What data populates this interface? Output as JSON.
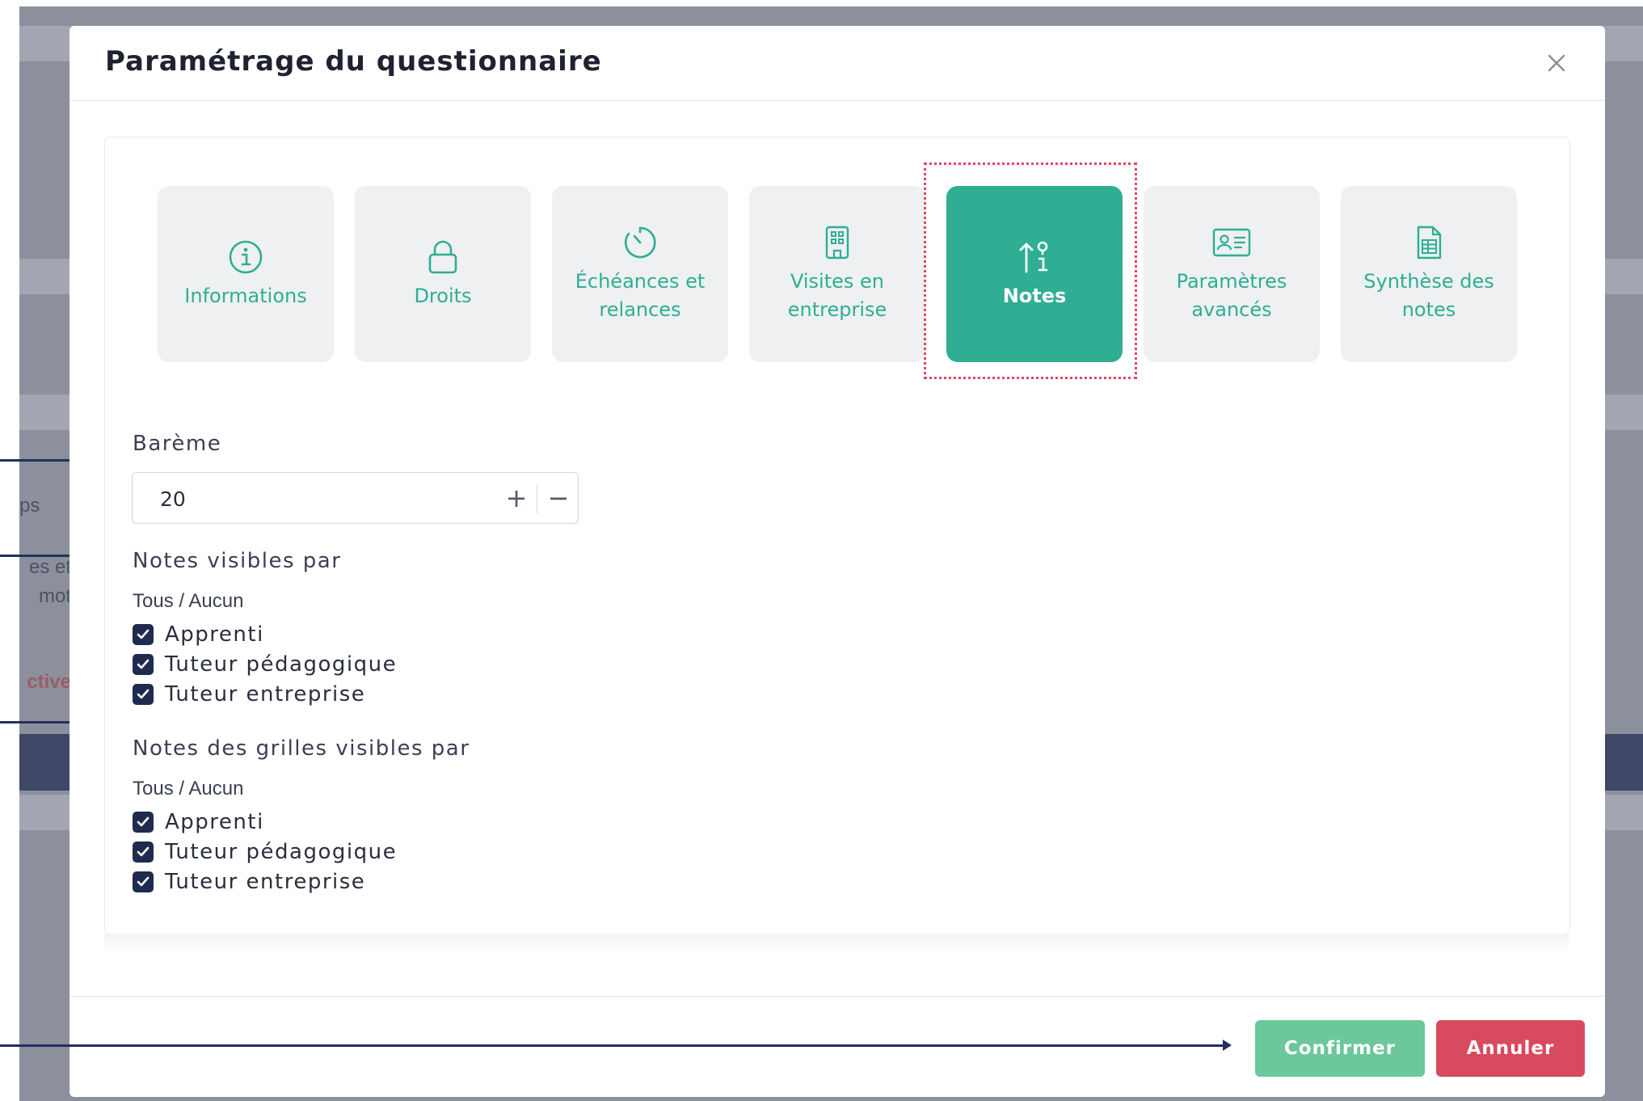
{
  "background": {
    "fragments": [
      "ps",
      "es et",
      "mot",
      "ctive"
    ]
  },
  "modal": {
    "title": "Paramétrage du questionnaire",
    "close_icon": "close-icon"
  },
  "tabs": [
    {
      "label_line1": "Informations",
      "label_line2": "",
      "icon": "info-icon",
      "active": false
    },
    {
      "label_line1": "Droits",
      "label_line2": "",
      "icon": "lock-icon",
      "active": false
    },
    {
      "label_line1": "Échéances et",
      "label_line2": "relances",
      "icon": "timer-icon",
      "active": false
    },
    {
      "label_line1": "Visites en",
      "label_line2": "entreprise",
      "icon": "building-icon",
      "active": false
    },
    {
      "label_line1": "Notes",
      "label_line2": "",
      "icon": "grade-sort-icon",
      "active": true
    },
    {
      "label_line1": "Paramètres",
      "label_line2": "avancés",
      "icon": "id-card-icon",
      "active": false
    },
    {
      "label_line1": "Synthèse des",
      "label_line2": "notes",
      "icon": "spreadsheet-icon",
      "active": false
    }
  ],
  "bareme": {
    "label": "Barème",
    "value": "20",
    "plus": "+",
    "minus": "−"
  },
  "notes_visibles": {
    "label": "Notes visibles par",
    "toggle_all": "Tous / Aucun",
    "options": [
      {
        "label": "Apprenti",
        "checked": true
      },
      {
        "label": "Tuteur pédagogique",
        "checked": true
      },
      {
        "label": "Tuteur entreprise",
        "checked": true
      }
    ]
  },
  "notes_grilles": {
    "label": "Notes des grilles visibles par",
    "toggle_all": "Tous / Aucun",
    "options": [
      {
        "label": "Apprenti",
        "checked": true
      },
      {
        "label": "Tuteur pédagogique",
        "checked": true
      },
      {
        "label": "Tuteur entreprise",
        "checked": true
      }
    ]
  },
  "footer": {
    "confirm_label": "Confirmer",
    "cancel_label": "Annuler"
  },
  "colors": {
    "accent": "#2fae94",
    "confirm": "#6cc79a",
    "cancel": "#d84a5d",
    "checkbox": "#1f2b4e",
    "highlight": "#e5455e"
  }
}
